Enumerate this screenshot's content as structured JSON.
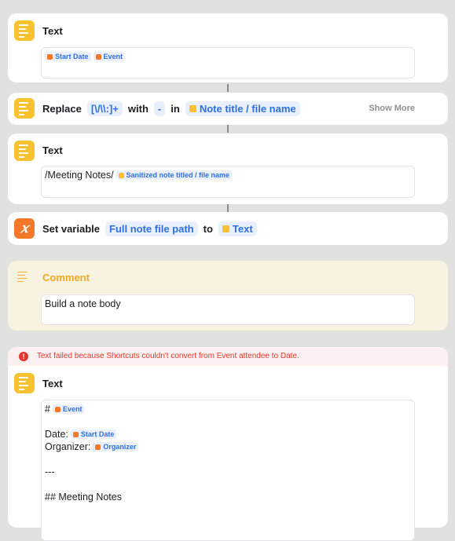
{
  "colors": {
    "accent": "#2f6fe4",
    "text_icon": "#f9c22e",
    "variable_icon": "#f4782a",
    "error": "#e5352b",
    "comment_title": "#f2a91e"
  },
  "actions": [
    {
      "title": "Text",
      "icon": "text-icon",
      "tokens": [
        "Start Date",
        "Event"
      ]
    },
    {
      "verb": "Replace",
      "pattern": "[\\/\\\\:]+",
      "with_label": "with",
      "replacement": "-",
      "in_label": "in",
      "target": "Note title / file name",
      "show_more": "Show More"
    },
    {
      "title": "Text",
      "prefix": "/Meeting Notes/",
      "token": "Sanitized note titled / file name"
    },
    {
      "verb": "Set variable",
      "variable": "Full note file path",
      "to_label": "to",
      "value": "Text"
    }
  ],
  "comment": {
    "title": "Comment",
    "body": "Build a note body"
  },
  "error_action": {
    "error": "Text failed because Shortcuts couldn't convert from Event attendee to Date.",
    "title": "Text",
    "lines": {
      "l1_prefix": "#",
      "l1_token": "Event",
      "l2_prefix": "Date:",
      "l2_token": "Start Date",
      "l3_prefix": "Organizer:",
      "l3_token": "Organizer",
      "l4": "---",
      "l5": "## Meeting Notes"
    }
  }
}
